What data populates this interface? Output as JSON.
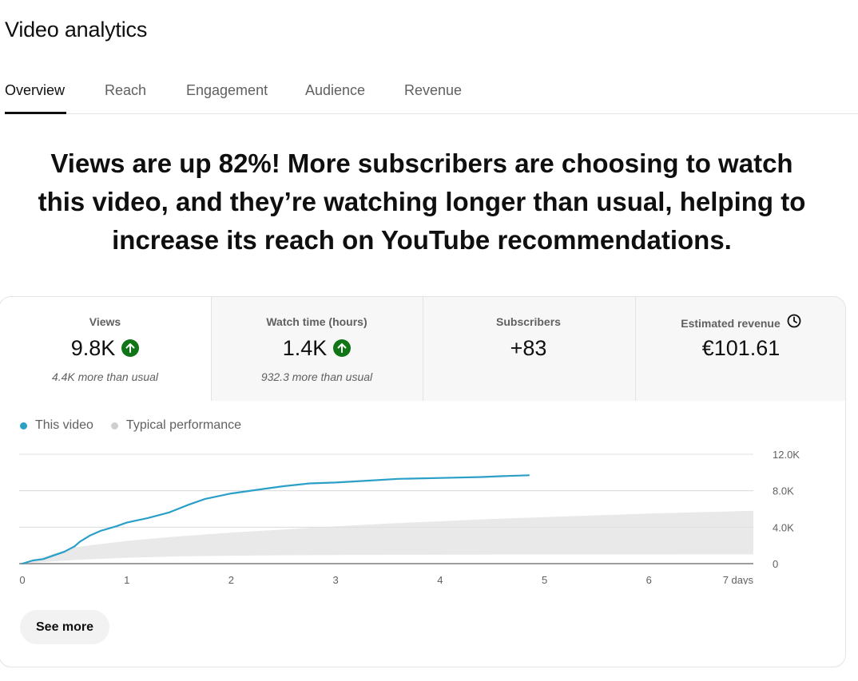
{
  "page": {
    "title": "Video analytics"
  },
  "tabs": [
    {
      "label": "Overview",
      "active": true
    },
    {
      "label": "Reach"
    },
    {
      "label": "Engagement"
    },
    {
      "label": "Audience"
    },
    {
      "label": "Revenue"
    }
  ],
  "headline": "Views are up 82%! More subscribers are choosing to watch this video, and they’re watching longer than usual, helping to increase its reach on YouTube recommendations.",
  "metrics": [
    {
      "label": "Views",
      "value": "9.8K",
      "trend": "up",
      "note": "4.4K more than usual",
      "selected": true
    },
    {
      "label": "Watch time (hours)",
      "value": "1.4K",
      "trend": "up",
      "note": "932.3 more than usual"
    },
    {
      "label": "Subscribers",
      "value": "+83"
    },
    {
      "label": "Estimated revenue",
      "value": "€101.61",
      "icon": "clock-icon"
    }
  ],
  "legend": [
    {
      "label": "This video",
      "color": "#2a9fc7"
    },
    {
      "label": "Typical performance",
      "color": "#cfcfcf"
    }
  ],
  "chart_data": {
    "type": "line",
    "x_ticks": [
      "0",
      "1",
      "2",
      "3",
      "4",
      "5",
      "6",
      "7 days"
    ],
    "y_ticks": [
      "12.0K",
      "8.0K",
      "4.0K",
      "0"
    ],
    "ylim": [
      0,
      12000
    ],
    "xlim": [
      0,
      7
    ],
    "grid": true,
    "series": [
      {
        "name": "This video",
        "color": "#2a9fc7",
        "x": [
          0,
          0.1,
          0.2,
          0.3,
          0.4,
          0.5,
          0.55,
          0.65,
          0.75,
          0.9,
          1.0,
          1.2,
          1.4,
          1.6,
          1.75,
          2.0,
          2.25,
          2.5,
          2.75,
          3.0,
          3.3,
          3.6,
          4.0,
          4.4,
          4.6,
          4.85
        ],
        "y": [
          0,
          350,
          500,
          900,
          1300,
          1900,
          2400,
          3100,
          3600,
          4100,
          4500,
          5000,
          5600,
          6500,
          7100,
          7700,
          8100,
          8500,
          8800,
          8900,
          9100,
          9300,
          9400,
          9500,
          9600,
          9700
        ]
      },
      {
        "name": "Typical performance",
        "color": "#e9e9e9",
        "band": true,
        "x": [
          0,
          0.5,
          1,
          1.5,
          2,
          2.5,
          3,
          3.5,
          4,
          4.5,
          5,
          5.5,
          6,
          6.5,
          7
        ],
        "lower": [
          0,
          400,
          650,
          800,
          870,
          920,
          950,
          970,
          985,
          995,
          1000,
          1005,
          1010,
          1015,
          1020
        ],
        "upper": [
          0,
          1800,
          2500,
          3000,
          3400,
          3750,
          4100,
          4400,
          4650,
          4900,
          5100,
          5300,
          5500,
          5650,
          5800
        ]
      }
    ]
  },
  "see_more_label": "See more"
}
